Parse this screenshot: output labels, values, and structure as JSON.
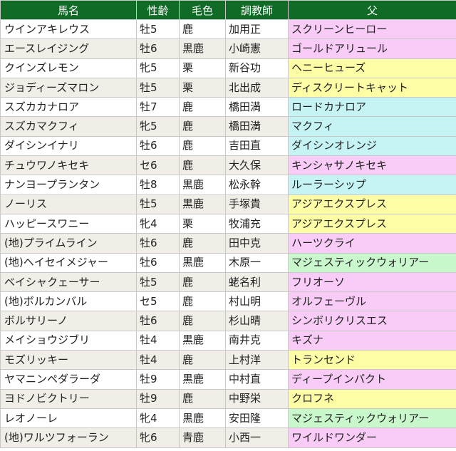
{
  "headers": {
    "name": "馬名",
    "sexage": "性齢",
    "color": "毛色",
    "trainer": "調教師",
    "sire": "父"
  },
  "colors": {
    "header_bg": "#0f6b25",
    "pink": "#f8ccf6",
    "yellow": "#fdfda6",
    "cyan": "#c6f4f4",
    "green": "#c8f8cc"
  },
  "rows": [
    {
      "name": "ウインアキレウス",
      "sexage": "牡5",
      "color": "鹿",
      "trainer": "加用正",
      "sire": "スクリーンヒーロー",
      "sire_color": "pink"
    },
    {
      "name": "エースレイジング",
      "sexage": "牡6",
      "color": "黒鹿",
      "trainer": "小崎憲",
      "sire": "ゴールドアリュール",
      "sire_color": "pink"
    },
    {
      "name": "クインズレモン",
      "sexage": "牝5",
      "color": "栗",
      "trainer": "新谷功",
      "sire": "ヘニーヒューズ",
      "sire_color": "yellow"
    },
    {
      "name": "ジョディーズマロン",
      "sexage": "牡5",
      "color": "栗",
      "trainer": "北出成",
      "sire": "ディスクリートキャット",
      "sire_color": "yellow"
    },
    {
      "name": "スズカカナロア",
      "sexage": "牡7",
      "color": "鹿",
      "trainer": "橋田満",
      "sire": "ロードカナロア",
      "sire_color": "cyan"
    },
    {
      "name": "スズカマクフィ",
      "sexage": "牝5",
      "color": "鹿",
      "trainer": "橋田満",
      "sire": "マクフィ",
      "sire_color": "cyan"
    },
    {
      "name": "ダイシンイナリ",
      "sexage": "牡6",
      "color": "鹿",
      "trainer": "吉田直",
      "sire": "ダイシンオレンジ",
      "sire_color": "cyan"
    },
    {
      "name": "チュウワノキセキ",
      "sexage": "セ6",
      "color": "鹿",
      "trainer": "大久保",
      "sire": "キンシャサノキセキ",
      "sire_color": "pink"
    },
    {
      "name": "ナンヨープランタン",
      "sexage": "牡8",
      "color": "黒鹿",
      "trainer": "松永幹",
      "sire": "ルーラーシップ",
      "sire_color": "cyan"
    },
    {
      "name": "ノーリス",
      "sexage": "牡5",
      "color": "黒鹿",
      "trainer": "手塚貴",
      "sire": "アジアエクスプレス",
      "sire_color": "yellow"
    },
    {
      "name": "ハッピースワニー",
      "sexage": "牝4",
      "color": "栗",
      "trainer": "牧浦充",
      "sire": "アジアエクスプレス",
      "sire_color": "yellow"
    },
    {
      "name": "(地)プライムライン",
      "sexage": "牡6",
      "color": "鹿",
      "trainer": "田中克",
      "sire": "ハーツクライ",
      "sire_color": "pink"
    },
    {
      "name": "(地)ヘイセイメジャー",
      "sexage": "牡6",
      "color": "黒鹿",
      "trainer": "木原一",
      "sire": "マジェスティックウォリアー",
      "sire_color": "green"
    },
    {
      "name": "ベイシャクェーサー",
      "sexage": "牡5",
      "color": "鹿",
      "trainer": "蛯名利",
      "sire": "フリオーソ",
      "sire_color": "pink"
    },
    {
      "name": "(地)ボルカンバル",
      "sexage": "セ5",
      "color": "鹿",
      "trainer": "村山明",
      "sire": "オルフェーヴル",
      "sire_color": "pink"
    },
    {
      "name": "ボルサリーノ",
      "sexage": "牡6",
      "color": "鹿",
      "trainer": "杉山晴",
      "sire": "シンボリクリスエス",
      "sire_color": "pink"
    },
    {
      "name": "メイショウジブリ",
      "sexage": "牡4",
      "color": "黒鹿",
      "trainer": "南井克",
      "sire": "キズナ",
      "sire_color": "pink"
    },
    {
      "name": "モズリッキー",
      "sexage": "牡4",
      "color": "鹿",
      "trainer": "上村洋",
      "sire": "トランセンド",
      "sire_color": "yellow"
    },
    {
      "name": "ヤマニンペダラーダ",
      "sexage": "牡9",
      "color": "黒鹿",
      "trainer": "中村直",
      "sire": "ディープインパクト",
      "sire_color": "pink"
    },
    {
      "name": "ヨドノビクトリー",
      "sexage": "牡9",
      "color": "鹿",
      "trainer": "中野栄",
      "sire": "クロフネ",
      "sire_color": "yellow"
    },
    {
      "name": "レオノーレ",
      "sexage": "牝4",
      "color": "黒鹿",
      "trainer": "安田隆",
      "sire": "マジェスティックウォリアー",
      "sire_color": "green"
    },
    {
      "name": "(地)ワルツフォーラン",
      "sexage": "牝6",
      "color": "青鹿",
      "trainer": "小西一",
      "sire": "ワイルドワンダー",
      "sire_color": "pink"
    }
  ]
}
